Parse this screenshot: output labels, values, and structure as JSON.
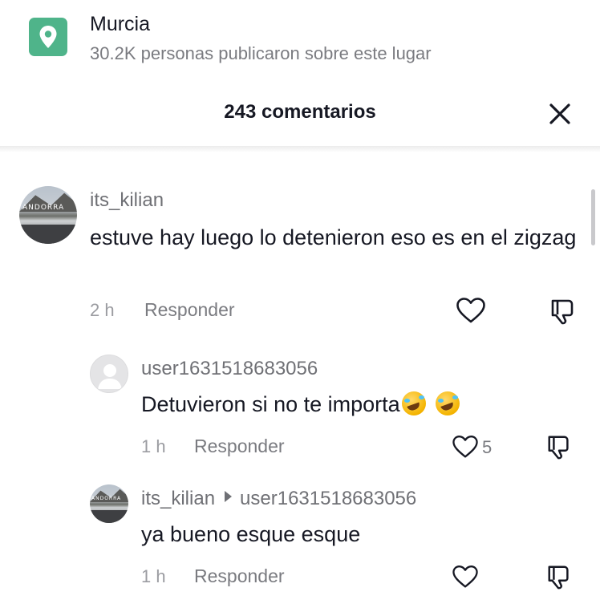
{
  "location": {
    "name": "Murcia",
    "subtitle": "30.2K personas publicaron sobre este lugar",
    "icon": "location-pin-icon",
    "accent_color": "#4fb48a"
  },
  "header": {
    "title": "243 comentarios",
    "close_icon": "close-icon"
  },
  "comments": [
    {
      "username": "its_kilian",
      "text": "estuve hay luego lo detenieron eso es en el zigzag",
      "time": "2 h",
      "reply_label": "Responder",
      "likes": "",
      "avatar_text": "ANDORRA"
    },
    {
      "username": "user1631518683056",
      "text": "Detuvieron si no te importa",
      "time": "1 h",
      "reply_label": "Responder",
      "likes": "5"
    },
    {
      "username": "its_kilian",
      "reply_to": "user1631518683056",
      "text": "ya bueno esque esque",
      "time": "1 h",
      "reply_label": "Responder",
      "likes": "",
      "avatar_text": "ANDORRA"
    }
  ]
}
